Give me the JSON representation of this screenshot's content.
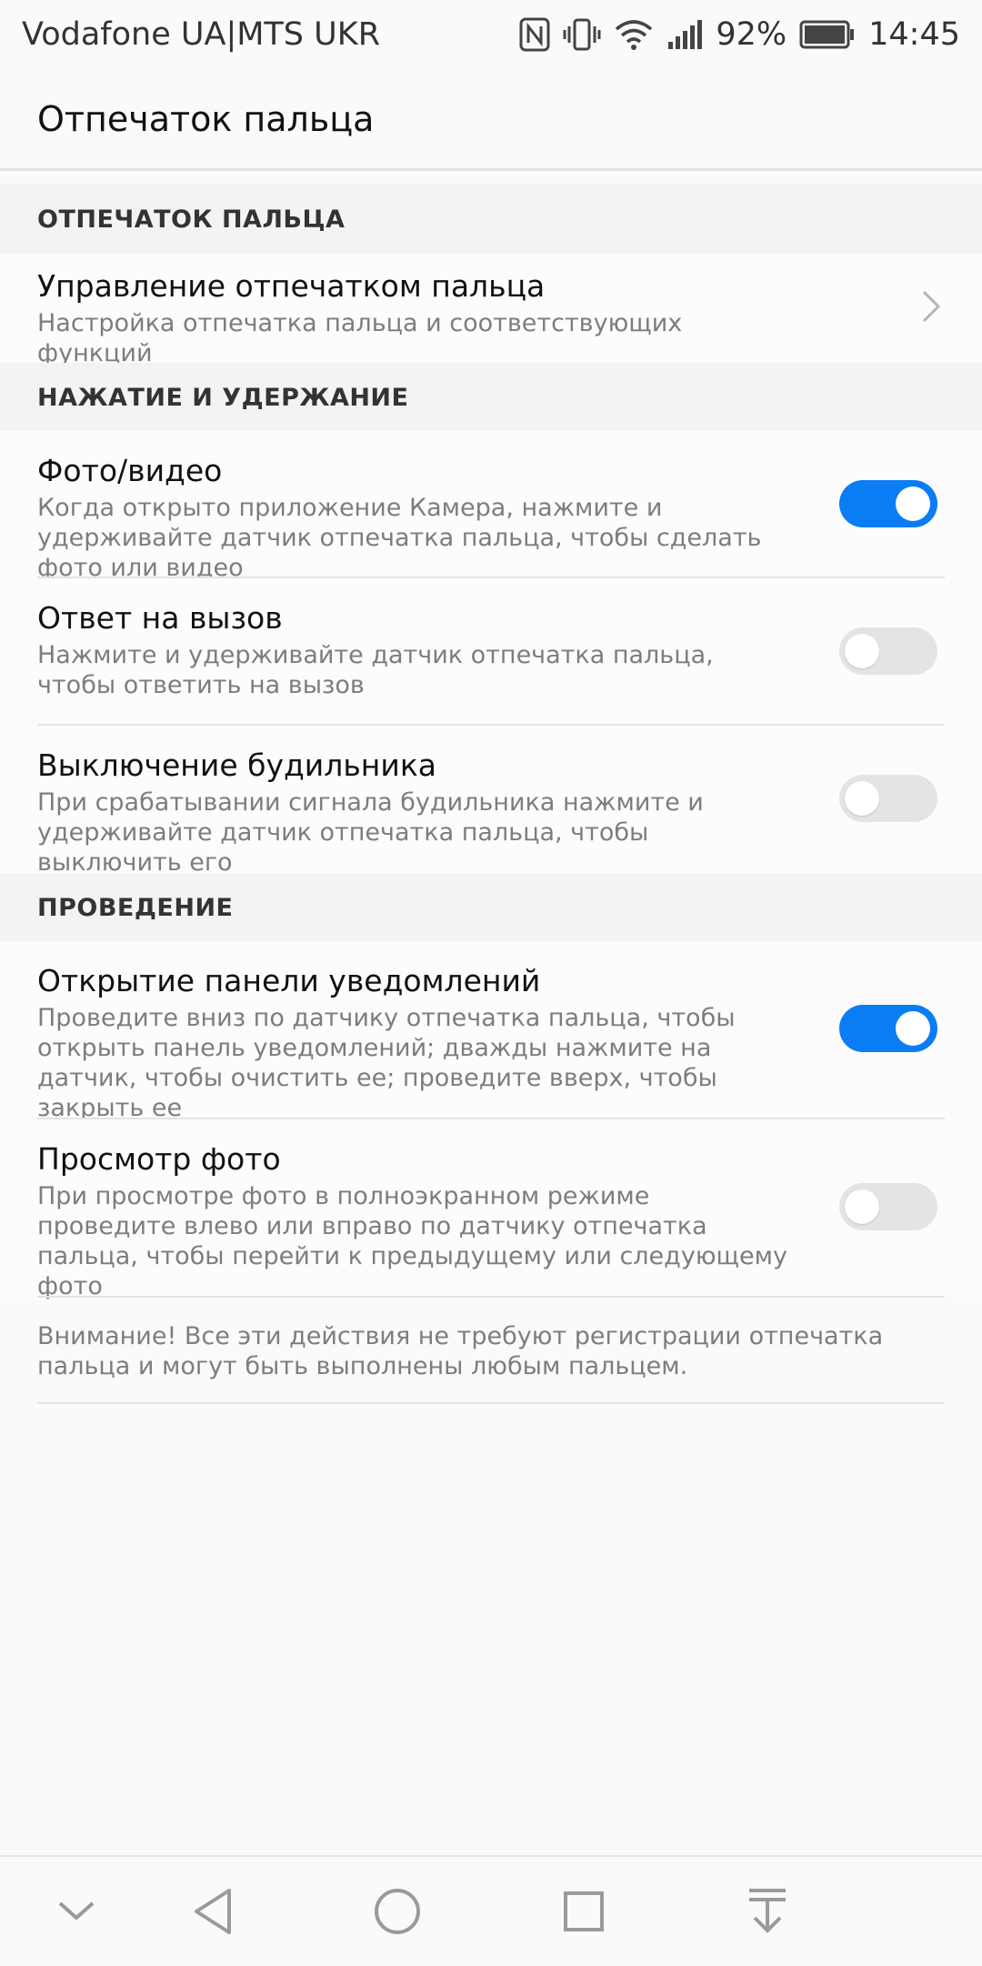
{
  "status_bar": {
    "carrier": "Vodafone UA|MTS UKR",
    "battery": "92%",
    "time": "14:45"
  },
  "app_bar": {
    "title": "Отпечаток пальца"
  },
  "sections": [
    {
      "header": "ОТПЕЧАТОК ПАЛЬЦА",
      "items": [
        {
          "title": "Управление отпечатком пальца",
          "desc": "Настройка отпечатка пальца и соответствующих функций"
        }
      ]
    },
    {
      "header": "НАЖАТИЕ И УДЕРЖАНИЕ",
      "items": [
        {
          "title": "Фото/видео",
          "desc": "Когда открыто приложение Камера, нажмите и удерживайте датчик отпечатка пальца, чтобы сделать фото или видео",
          "enabled": true
        },
        {
          "title": "Ответ на вызов",
          "desc": "Нажмите и удерживайте датчик отпечатка пальца, чтобы ответить на вызов",
          "enabled": false
        },
        {
          "title": "Выключение будильника",
          "desc": "При срабатывании сигнала будильника нажмите и удерживайте датчик отпечатка пальца, чтобы выключить его",
          "enabled": false
        }
      ]
    },
    {
      "header": "ПРОВЕДЕНИЕ",
      "items": [
        {
          "title": "Открытие панели уведомлений",
          "desc": "Проведите вниз по датчику отпечатка пальца, чтобы открыть панель уведомлений; дважды нажмите на датчик, чтобы очистить ее; проведите вверх, чтобы закрыть ее",
          "enabled": true
        },
        {
          "title": "Просмотр фото",
          "desc": "При просмотре фото в полноэкранном режиме проведите влево или вправо по датчику отпечатка пальца, чтобы перейти к предыдущему или следующему фото",
          "enabled": false
        }
      ]
    }
  ],
  "note": "Внимание! Все эти действия не требуют регистрации отпечатка пальца и могут быть выполнены любым пальцем.",
  "colors": {
    "accent": "#0a7cf4",
    "toggle_off": "#e4e4e4",
    "section_bg": "#f3f3f3"
  },
  "icons": [
    "nfc-icon",
    "vibrate-icon",
    "wifi-icon",
    "signal-icon",
    "battery-icon",
    "chevron-right-icon",
    "nav-down-icon",
    "nav-back-icon",
    "nav-home-icon",
    "nav-recents-icon",
    "nav-pull-down-icon"
  ]
}
